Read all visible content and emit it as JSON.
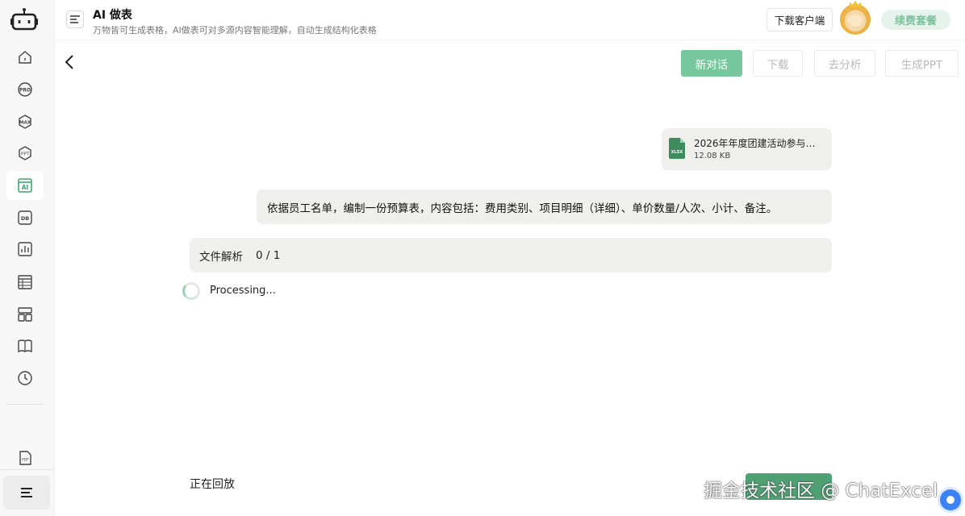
{
  "header": {
    "title": "AI 做表",
    "subtitle": "万物皆可生成表格，AI做表可对多源内容智能理解，自动生成结构化表格",
    "download_client": "下载客户端",
    "renew": "续费套餐"
  },
  "sidebar": {
    "items": [
      {
        "icon": "home-icon"
      },
      {
        "icon": "pro-icon",
        "text": "PRO"
      },
      {
        "icon": "max-icon",
        "text": "MAX"
      },
      {
        "icon": "ppt-icon",
        "text": "PPT"
      },
      {
        "icon": "ai-table-icon",
        "text": "AI",
        "active": true
      },
      {
        "icon": "db-icon",
        "text": "DB"
      },
      {
        "icon": "chart-icon"
      },
      {
        "icon": "table-icon"
      },
      {
        "icon": "layout-icon"
      },
      {
        "icon": "book-icon"
      },
      {
        "icon": "history-icon"
      }
    ],
    "pdf_icon_text": "PDF"
  },
  "toolbar": {
    "new_chat": "新对话",
    "download": "下载",
    "analyze": "去分析",
    "generate_ppt": "生成PPT"
  },
  "chat": {
    "file": {
      "name": "2026年年度团建活动参与…",
      "size": "12.08 KB",
      "type_label": "XLSX"
    },
    "user_message": "依据员工名单，编制一份预算表，内容包括：费用类别、项目明细（详细）、单价数量/人次、小计、备注。",
    "parse_label": "文件解析",
    "parse_count": "0 / 1",
    "processing": "Processing..."
  },
  "footer": {
    "replying": "正在回放",
    "watermark": "掘金技术社区 @ ChatExcel"
  },
  "colors": {
    "accent": "#76c89c",
    "accent_dark": "#4fa173",
    "bubble": "#efefed"
  }
}
